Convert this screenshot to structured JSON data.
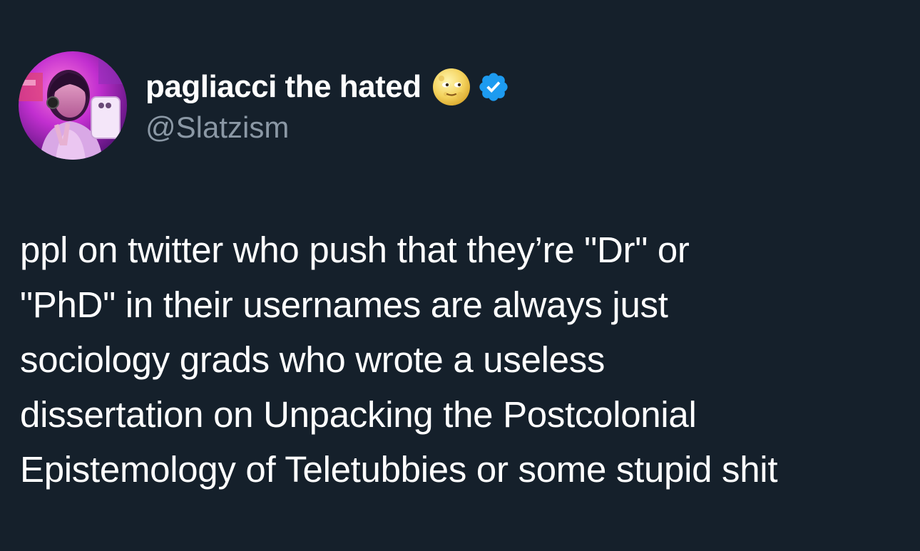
{
  "theme": {
    "background": "#15202b",
    "text_primary": "#ffffff",
    "text_secondary": "#8b98a5",
    "verified_badge": "#1d9bf0"
  },
  "author": {
    "display_name": "pagliacci the hated",
    "handle": "@Slatzism",
    "name_emoji": "full-moon-face-emoji",
    "verified": true,
    "verified_icon": "verified-badge-icon",
    "avatar": "profile-avatar"
  },
  "tweet": {
    "lines": [
      "ppl on twitter who push that they’re \"Dr\" or",
      "\"PhD\" in their usernames are always just",
      "sociology grads who wrote a useless",
      "dissertation on Unpacking the Postcolonial",
      "Epistemology of Teletubbies or some stupid shit"
    ]
  }
}
